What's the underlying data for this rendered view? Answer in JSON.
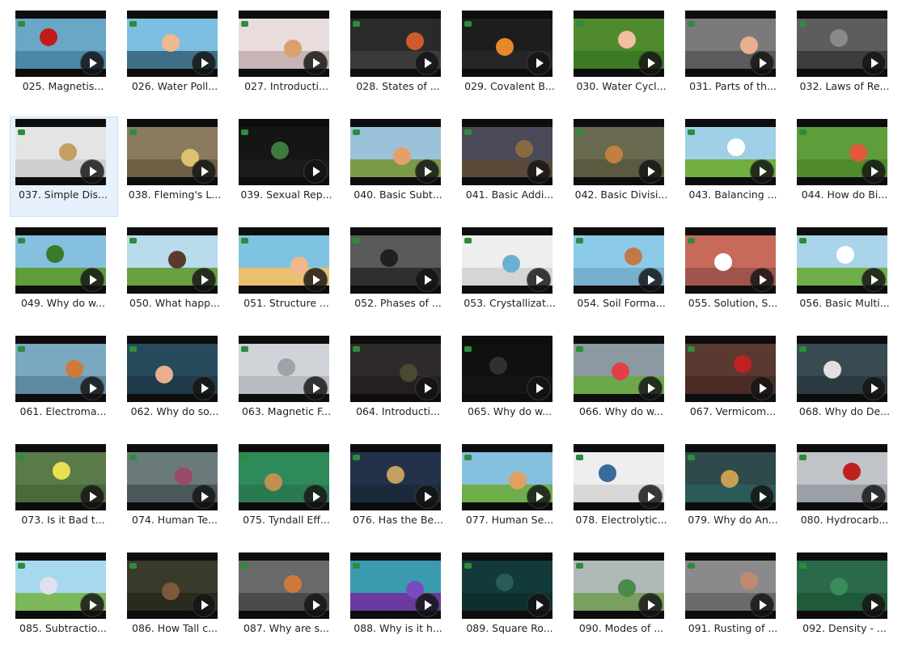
{
  "window": {
    "title": ""
  },
  "colors": {
    "selection_bg": "#e6f1fd",
    "selection_border": "#c7dff7",
    "thumb_frame": "#0d0d0d",
    "label_text": "#222222"
  },
  "icons": {
    "play": "play-icon",
    "brand": "brand-logo-icon"
  },
  "files": [
    {
      "label": "025. Magnetis...",
      "sky": "#6aa7c7",
      "ground": "#4c86a8",
      "accent": "#c21b1b"
    },
    {
      "label": "026. Water Poll...",
      "sky": "#7cbfe0",
      "ground": "#3f6f86",
      "accent": "#f0b88c"
    },
    {
      "label": "027. Introducti...",
      "sky": "#e9dcdc",
      "ground": "#c8b4b4",
      "accent": "#d9a26a"
    },
    {
      "label": "028. States of ...",
      "sky": "#2a2a2a",
      "ground": "#3a3a3a",
      "accent": "#cc5a2a"
    },
    {
      "label": "029. Covalent B...",
      "sky": "#1d1d1d",
      "ground": "#262626",
      "accent": "#e48a2c"
    },
    {
      "label": "030. Water Cycl...",
      "sky": "#4f8a2f",
      "ground": "#3c7a24",
      "accent": "#f0c0a0"
    },
    {
      "label": "031. Parts of th...",
      "sky": "#7a7a7a",
      "ground": "#5b5b5b",
      "accent": "#e8b090"
    },
    {
      "label": "032. Laws of Re...",
      "sky": "#5d5d5d",
      "ground": "#3d3d3d",
      "accent": "#8a8a8a"
    },
    {
      "label": "037. Simple Dis...",
      "sky": "#e4e4e4",
      "ground": "#cfcfcf",
      "accent": "#c4a060",
      "selected": true
    },
    {
      "label": "038. Fleming's L...",
      "sky": "#8a7a60",
      "ground": "#6e5e44",
      "accent": "#e0c070"
    },
    {
      "label": "039. Sexual Rep...",
      "sky": "#151515",
      "ground": "#1b1b1b",
      "accent": "#3d7a3d"
    },
    {
      "label": "040. Basic Subt...",
      "sky": "#9ac3db",
      "ground": "#7a9a4a",
      "accent": "#e4a06a"
    },
    {
      "label": "041. Basic Addi...",
      "sky": "#4a4a5a",
      "ground": "#5a4a3a",
      "accent": "#8a6a40"
    },
    {
      "label": "042. Basic Divisi...",
      "sky": "#6a6a50",
      "ground": "#5a5a40",
      "accent": "#c08040"
    },
    {
      "label": "043. Balancing ...",
      "sky": "#9fd0e8",
      "ground": "#6fae3f",
      "accent": "#ffffff"
    },
    {
      "label": "044. How do Bi...",
      "sky": "#5e9d3a",
      "ground": "#4f8a2c",
      "accent": "#e05a3a"
    },
    {
      "label": "049. Why do w...",
      "sky": "#86c0df",
      "ground": "#5f9d3a",
      "accent": "#3a7a2a"
    },
    {
      "label": "050. What happ...",
      "sky": "#b9dbec",
      "ground": "#6aa042",
      "accent": "#5a3a2a"
    },
    {
      "label": "051. Structure ...",
      "sky": "#7ec4e2",
      "ground": "#e8c070",
      "accent": "#f0b88c"
    },
    {
      "label": "052. Phases of ...",
      "sky": "#5a5a5a",
      "ground": "#2f2f2f",
      "accent": "#202020"
    },
    {
      "label": "053. Crystallizat...",
      "sky": "#eeeeee",
      "ground": "#d5d5d5",
      "accent": "#6ab0d0"
    },
    {
      "label": "054. Soil Forma...",
      "sky": "#8ccbe8",
      "ground": "#77b0cf",
      "accent": "#c07a4a"
    },
    {
      "label": "055. Solution, S...",
      "sky": "#c76a5a",
      "ground": "#a0544a",
      "accent": "#ffffff"
    },
    {
      "label": "056. Basic Multi...",
      "sky": "#a9d4ea",
      "ground": "#6fae4a",
      "accent": "#ffffff"
    },
    {
      "label": "061. Electroma...",
      "sky": "#7aa8c0",
      "ground": "#5d8aa0",
      "accent": "#d07a3a"
    },
    {
      "label": "062. Why do so...",
      "sky": "#274a5d",
      "ground": "#1f3a4a",
      "accent": "#e8b090"
    },
    {
      "label": "063. Magnetic F...",
      "sky": "#d0d4d8",
      "ground": "#b8bcc0",
      "accent": "#9aa4aa"
    },
    {
      "label": "064. Introducti...",
      "sky": "#2f2a2a",
      "ground": "#252020",
      "accent": "#4a4a30"
    },
    {
      "label": "065. Why do w...",
      "sky": "#101010",
      "ground": "#141414",
      "accent": "#303030"
    },
    {
      "label": "066. Why do w...",
      "sky": "#8a9aa0",
      "ground": "#6ca84a",
      "accent": "#e0404a"
    },
    {
      "label": "067. Vermicom...",
      "sky": "#5a3a30",
      "ground": "#4a2a22",
      "accent": "#c02020"
    },
    {
      "label": "068. Why do De...",
      "sky": "#3a4a52",
      "ground": "#2a3a40",
      "accent": "#e0e0e0"
    },
    {
      "label": "073. Is it Bad t...",
      "sky": "#5a7a4a",
      "ground": "#4a6a3a",
      "accent": "#e8e050"
    },
    {
      "label": "074. Human Te...",
      "sky": "#6a7a7a",
      "ground": "#4a5a5a",
      "accent": "#9a4a6a"
    },
    {
      "label": "075. Tyndall Eff...",
      "sky": "#2f8a5a",
      "ground": "#2a7a50",
      "accent": "#c09050"
    },
    {
      "label": "076. Has the Be...",
      "sky": "#23324a",
      "ground": "#1a2a3a",
      "accent": "#c4a060"
    },
    {
      "label": "077. Human Se...",
      "sky": "#86c0df",
      "ground": "#6fae4a",
      "accent": "#e0a060"
    },
    {
      "label": "078. Electrolytic...",
      "sky": "#eeeeee",
      "ground": "#d8d8d8",
      "accent": "#3a6a9a"
    },
    {
      "label": "079. Why do An...",
      "sky": "#2f4a4a",
      "ground": "#2a5a5a",
      "accent": "#c8a050"
    },
    {
      "label": "080. Hydrocarb...",
      "sky": "#c0c4c8",
      "ground": "#9aa0a6",
      "accent": "#c02020"
    },
    {
      "label": "085. Subtractio...",
      "sky": "#a8d8ee",
      "ground": "#7ab85a",
      "accent": "#e0e0f0"
    },
    {
      "label": "086. How Tall c...",
      "sky": "#3a3a2a",
      "ground": "#2a2a1e",
      "accent": "#7a5a3a"
    },
    {
      "label": "087. Why are s...",
      "sky": "#6a6a6a",
      "ground": "#4a4a4a",
      "accent": "#d07a3a"
    },
    {
      "label": "088. Why is it h...",
      "sky": "#3a9ab0",
      "ground": "#6a3aa0",
      "accent": "#7a4ac0"
    },
    {
      "label": "089. Square Ro...",
      "sky": "#123a3a",
      "ground": "#0f2f2f",
      "accent": "#2a5a5a"
    },
    {
      "label": "090. Modes of ...",
      "sky": "#b0b8b8",
      "ground": "#7aa060",
      "accent": "#4a8a4a"
    },
    {
      "label": "091. Rusting of ...",
      "sky": "#8a8a8a",
      "ground": "#6a6a6a",
      "accent": "#c08a70"
    },
    {
      "label": "092. Density - ...",
      "sky": "#2a6a4a",
      "ground": "#1f5a3a",
      "accent": "#3a8a5a"
    }
  ]
}
